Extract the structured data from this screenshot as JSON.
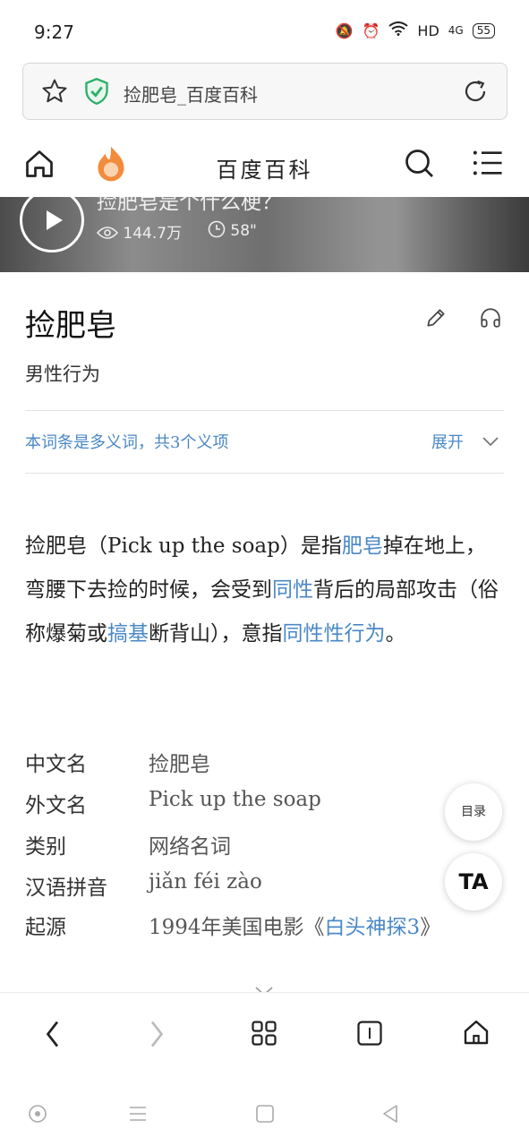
{
  "status_bar": {
    "time": "9:27",
    "network": "HD",
    "signal": "4G",
    "battery": "55"
  },
  "address_bar": {
    "page_title": "捡肥皂_百度百科"
  },
  "nav": {
    "brand": "百度百科"
  },
  "video": {
    "title": "捡肥皂是个什么梗？",
    "views": "144.7万",
    "duration": "58\""
  },
  "entry": {
    "title": "捡肥皂",
    "subtitle": "男性行为",
    "polysemy_text": "本词条是多义词，共3个义项",
    "expand_label": "展开"
  },
  "summary": {
    "t1": "捡肥皂（Pick up the soap）是指",
    "l1": "肥皂",
    "t2": "掉在地上，弯腰下去捡的时候，会受到",
    "l2": "同性",
    "t3": "背后的局部攻击（俗称爆菊或",
    "l3": "搞基",
    "t4": "断背山），意指",
    "l4": "同性性行为",
    "t5": "。"
  },
  "info": {
    "rows": [
      {
        "key": "中文名",
        "value": "捡肥皂"
      },
      {
        "key": "外文名",
        "value": "Pick up the soap"
      },
      {
        "key": "类别",
        "value": "网络名词"
      },
      {
        "key": "汉语拼音",
        "value": "jiǎn féi zào"
      }
    ],
    "origin_key": "起源",
    "origin_prefix": "1994年美国电影《",
    "origin_link": "白头神探3",
    "origin_suffix": "》"
  },
  "floating": {
    "toc_label": "目录",
    "ta_label": "TA"
  },
  "colors": {
    "link": "#4a88c7",
    "brand_orange": "#f28b3c",
    "shield_green": "#2aae67"
  }
}
